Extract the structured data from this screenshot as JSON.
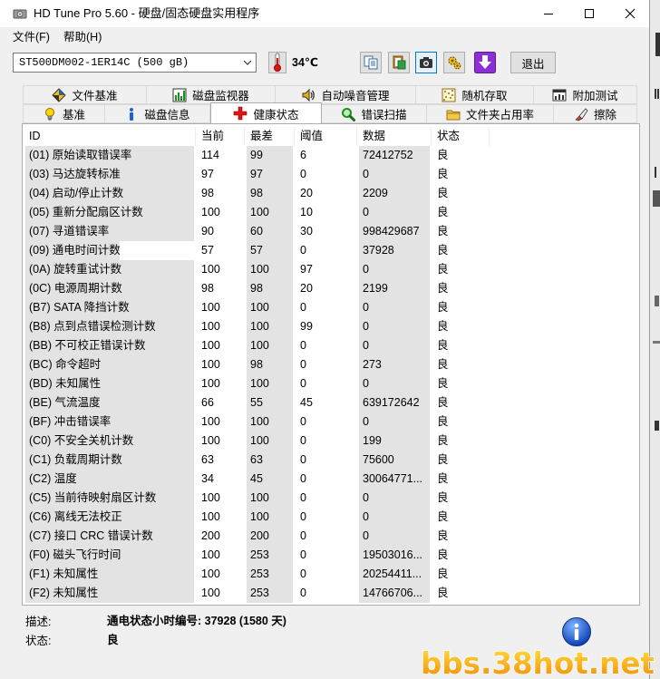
{
  "window": {
    "title": "HD Tune Pro 5.60 - 硬盘/固态硬盘实用程序",
    "app_icon": "disk-icon"
  },
  "menu": [
    {
      "label": "文件(F)"
    },
    {
      "label": "帮助(H)"
    }
  ],
  "toolbar": {
    "drive": "ST500DM002-1ER14C (500 gB)",
    "temperature": "34℃",
    "temperature_icon": "thermometer-icon",
    "tools": [
      {
        "icon": "copy-text-icon"
      },
      {
        "icon": "copy-info-icon"
      },
      {
        "icon": "screenshot-icon"
      },
      {
        "icon": "options-icon"
      },
      {
        "icon": "save-icon"
      }
    ],
    "exit_label": "退出"
  },
  "tabs_top": [
    {
      "label": "文件基准",
      "icon": "file-benchmark-icon"
    },
    {
      "label": "磁盘监视器",
      "icon": "disk-monitor-icon"
    },
    {
      "label": "自动噪音管理",
      "icon": "speaker-icon"
    },
    {
      "label": "随机存取",
      "icon": "random-access-icon"
    },
    {
      "label": "附加测试",
      "icon": "extra-tests-icon"
    }
  ],
  "tabs_bottom": [
    {
      "label": "基准",
      "icon": "lightbulb-icon"
    },
    {
      "label": "磁盘信息",
      "icon": "info-i-icon"
    },
    {
      "label": "健康状态",
      "icon": "red-cross-icon",
      "selected": true
    },
    {
      "label": "错误扫描",
      "icon": "magnifier-icon"
    },
    {
      "label": "文件夹占用率",
      "icon": "folder-icon"
    },
    {
      "label": "擦除",
      "icon": "eraser-icon"
    }
  ],
  "smart": {
    "headers": [
      "ID",
      "当前",
      "最差",
      "阈值",
      "数据",
      "状态"
    ],
    "rows": [
      {
        "id": "(01) 原始读取错误率",
        "current": "114",
        "worst": "99",
        "threshold": "6",
        "data": "72412752",
        "status": "良"
      },
      {
        "id": "(03) 马达旋转标准",
        "current": "97",
        "worst": "97",
        "threshold": "0",
        "data": "0",
        "status": "良"
      },
      {
        "id": "(04) 启动/停止计数",
        "current": "98",
        "worst": "98",
        "threshold": "20",
        "data": "2209",
        "status": "良"
      },
      {
        "id": "(05) 重新分配扇区计数",
        "current": "100",
        "worst": "100",
        "threshold": "10",
        "data": "0",
        "status": "良"
      },
      {
        "id": "(07) 寻道错误率",
        "current": "90",
        "worst": "60",
        "threshold": "30",
        "data": "998429687",
        "status": "良"
      },
      {
        "id": "(09) 通电时间计数",
        "current": "57",
        "worst": "57",
        "threshold": "0",
        "data": "37928",
        "status": "良"
      },
      {
        "id": "(0A) 旋转重试计数",
        "current": "100",
        "worst": "100",
        "threshold": "97",
        "data": "0",
        "status": "良"
      },
      {
        "id": "(0C) 电源周期计数",
        "current": "98",
        "worst": "98",
        "threshold": "20",
        "data": "2199",
        "status": "良"
      },
      {
        "id": "(B7) SATA 降挡计数",
        "current": "100",
        "worst": "100",
        "threshold": "0",
        "data": "0",
        "status": "良"
      },
      {
        "id": "(B8) 点到点错误检测计数",
        "current": "100",
        "worst": "100",
        "threshold": "99",
        "data": "0",
        "status": "良"
      },
      {
        "id": "(BB) 不可校正错误计数",
        "current": "100",
        "worst": "100",
        "threshold": "0",
        "data": "0",
        "status": "良"
      },
      {
        "id": "(BC) 命令超时",
        "current": "100",
        "worst": "98",
        "threshold": "0",
        "data": "273",
        "status": "良"
      },
      {
        "id": "(BD) 未知属性",
        "current": "100",
        "worst": "100",
        "threshold": "0",
        "data": "0",
        "status": "良"
      },
      {
        "id": "(BE) 气流温度",
        "current": "66",
        "worst": "55",
        "threshold": "45",
        "data": "639172642",
        "status": "良"
      },
      {
        "id": "(BF) 冲击错误率",
        "current": "100",
        "worst": "100",
        "threshold": "0",
        "data": "0",
        "status": "良"
      },
      {
        "id": "(C0) 不安全关机计数",
        "current": "100",
        "worst": "100",
        "threshold": "0",
        "data": "199",
        "status": "良"
      },
      {
        "id": "(C1) 负载周期计数",
        "current": "63",
        "worst": "63",
        "threshold": "0",
        "data": "75600",
        "status": "良"
      },
      {
        "id": "(C2) 温度",
        "current": "34",
        "worst": "45",
        "threshold": "0",
        "data": "30064771...",
        "status": "良"
      },
      {
        "id": "(C5) 当前待映射扇区计数",
        "current": "100",
        "worst": "100",
        "threshold": "0",
        "data": "0",
        "status": "良"
      },
      {
        "id": "(C6) 离线无法校正",
        "current": "100",
        "worst": "100",
        "threshold": "0",
        "data": "0",
        "status": "良"
      },
      {
        "id": "(C7) 接口 CRC 错误计数",
        "current": "200",
        "worst": "200",
        "threshold": "0",
        "data": "0",
        "status": "良"
      },
      {
        "id": "(F0) 磁头飞行时间",
        "current": "100",
        "worst": "253",
        "threshold": "0",
        "data": "19503016...",
        "status": "良"
      },
      {
        "id": "(F1) 未知属性",
        "current": "100",
        "worst": "253",
        "threshold": "0",
        "data": "20254411...",
        "status": "良"
      },
      {
        "id": "(F2) 未知属性",
        "current": "100",
        "worst": "253",
        "threshold": "0",
        "data": "14766706...",
        "status": "良"
      }
    ]
  },
  "footer": {
    "desc_label": "描述:",
    "desc_value": "通电状态小时编号: 37928 (1580 天)",
    "status_label": "状态:",
    "status_value": "良",
    "info_icon": "info-icon"
  },
  "watermark": "bbs.38hot.net",
  "colors": {
    "health_icon": "#e01515",
    "save_button": "#8d2fd6",
    "info_icon": "#1f5fd6",
    "watermark": "#f0a000"
  }
}
